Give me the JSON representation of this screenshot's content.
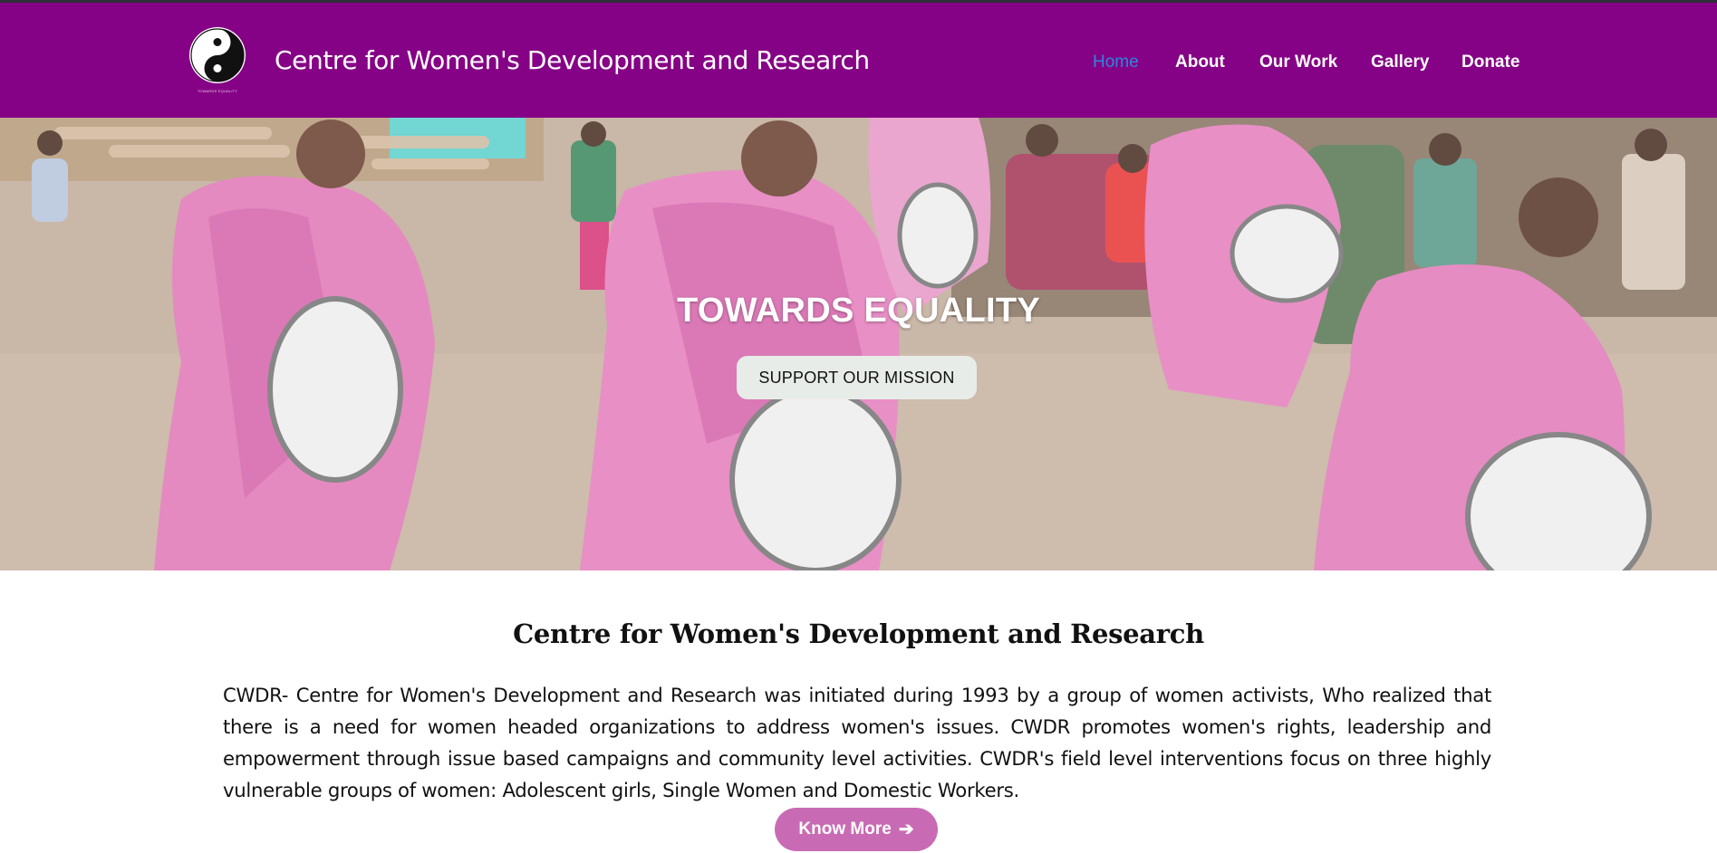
{
  "header": {
    "site_title": "Centre for Women's Development and Research",
    "logo_caption": "TOWARDS EQUALITY",
    "logo_icon": "yin-yang-logo",
    "nav": [
      {
        "label": "Home",
        "active": true
      },
      {
        "label": "About",
        "active": false
      },
      {
        "label": "Our Work",
        "active": false
      },
      {
        "label": "Gallery",
        "active": false
      },
      {
        "label": "Donate",
        "active": false
      }
    ]
  },
  "hero": {
    "title": "TOWARDS EQUALITY",
    "button_label": "SUPPORT OUR MISSION"
  },
  "intro": {
    "heading": "Centre for Women's Development and Research",
    "body": "CWDR- Centre for Women's Development and Research was initiated during 1993 by a group of women activists, Who realized that there is a need for women headed organizations to address women's issues. CWDR promotes women's rights, leadership and empowerment through issue based campaigns and community level activities. CWDR's field level interventions focus on three highly vulnerable groups of women: Adolescent girls, Single Women and Domestic Workers.",
    "button_label": "Know More",
    "button_icon": "arrow-right-icon"
  },
  "colors": {
    "header_bg": "#850185",
    "nav_active": "#2f86e2",
    "button_accent": "#c96bb4"
  }
}
